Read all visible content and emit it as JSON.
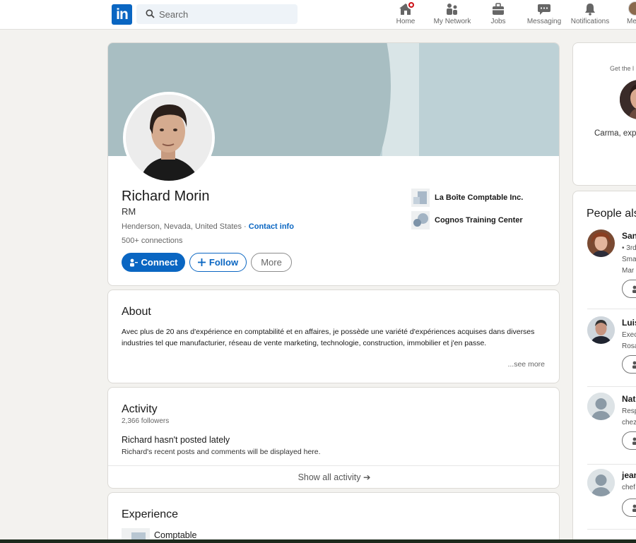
{
  "nav": {
    "search_placeholder": "Search",
    "items": [
      {
        "label": "Home",
        "icon": "home-icon"
      },
      {
        "label": "My Network",
        "icon": "network-icon"
      },
      {
        "label": "Jobs",
        "icon": "briefcase-icon"
      },
      {
        "label": "Messaging",
        "icon": "chat-icon"
      },
      {
        "label": "Notifications",
        "icon": "bell-icon"
      },
      {
        "label": "Me",
        "icon": "avatar-icon"
      }
    ]
  },
  "profile": {
    "name": "Richard Morin",
    "headline": "RM",
    "location": "Henderson, Nevada, United States",
    "separator": " · ",
    "contact_info": "Contact info",
    "connections": "500+ connections",
    "connect_label": "Connect",
    "follow_label": "Follow",
    "more_label": "More",
    "companies": [
      {
        "name": "La Boîte Comptable Inc."
      },
      {
        "name": "Cognos Training Center"
      }
    ]
  },
  "about": {
    "title": "About",
    "text": "Avec plus de 20 ans d'expérience en comptabilité et en affaires, je possède une variété d'expériences acquises dans diverses industries tel que manufacturier, réseau de vente marketing, technologie, construction, immobilier et j'en passe.",
    "see_more": "...see more"
  },
  "activity": {
    "title": "Activity",
    "followers": "2,366 followers",
    "empty_title": "Richard hasn't posted lately",
    "empty_sub": "Richard's recent posts and comments will be displayed here.",
    "show_all": "Show all activity ➔"
  },
  "experience": {
    "title": "Experience",
    "first_item": "Comptable"
  },
  "ad": {
    "text": "Get the l",
    "name": "Carma, exp"
  },
  "people_also_viewed": {
    "title": "People als",
    "people": [
      {
        "name": "San",
        "line1": "• 3rd",
        "line2": "Sma",
        "line3": "Mar"
      },
      {
        "name": "Luis",
        "line1": "Exec",
        "line2": "Rosa",
        "line3": ""
      },
      {
        "name": "Nat",
        "line1": "Resp",
        "line2": "chez",
        "line3": ""
      },
      {
        "name": "jean",
        "line1": "chef",
        "line2": "",
        "line3": ""
      }
    ]
  }
}
